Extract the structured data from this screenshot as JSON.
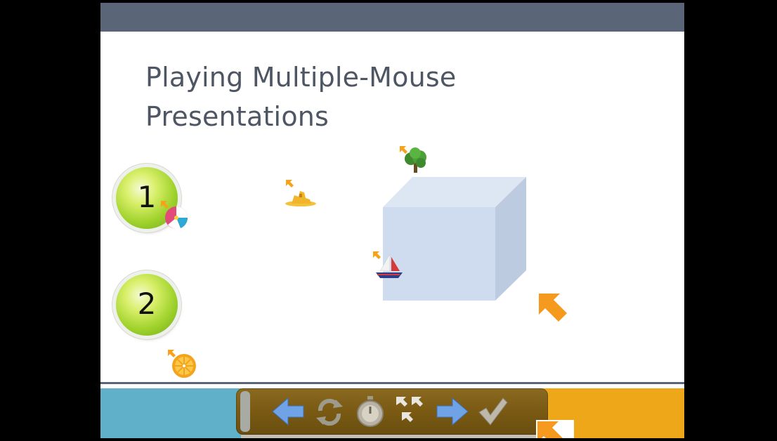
{
  "slide": {
    "title_line1": "Playing Multiple-Mouse",
    "title_line2": "Presentations",
    "badges": [
      {
        "label": "1"
      },
      {
        "label": "2"
      }
    ],
    "icons": [
      "beach-ball-icon",
      "sandcastle-icon",
      "tree-icon",
      "sailboat-icon",
      "orange-slice-icon"
    ],
    "cube_color": "#cfdcef",
    "accent_colors": {
      "topbar": "#5b6578",
      "left_band": "#5fb0c8",
      "right_band": "#efa71a",
      "cursor": "#f59a1e"
    }
  },
  "controlbar": {
    "buttons": [
      {
        "name": "previous-slide-button",
        "icon": "arrow-left-icon"
      },
      {
        "name": "rotate-turn-button",
        "icon": "rotate-icon"
      },
      {
        "name": "timer-button",
        "icon": "stopwatch-icon"
      },
      {
        "name": "mice-button",
        "icon": "cursors-icon"
      },
      {
        "name": "next-slide-button",
        "icon": "arrow-right-icon"
      },
      {
        "name": "check-answer-button",
        "icon": "checkmark-icon"
      }
    ]
  }
}
